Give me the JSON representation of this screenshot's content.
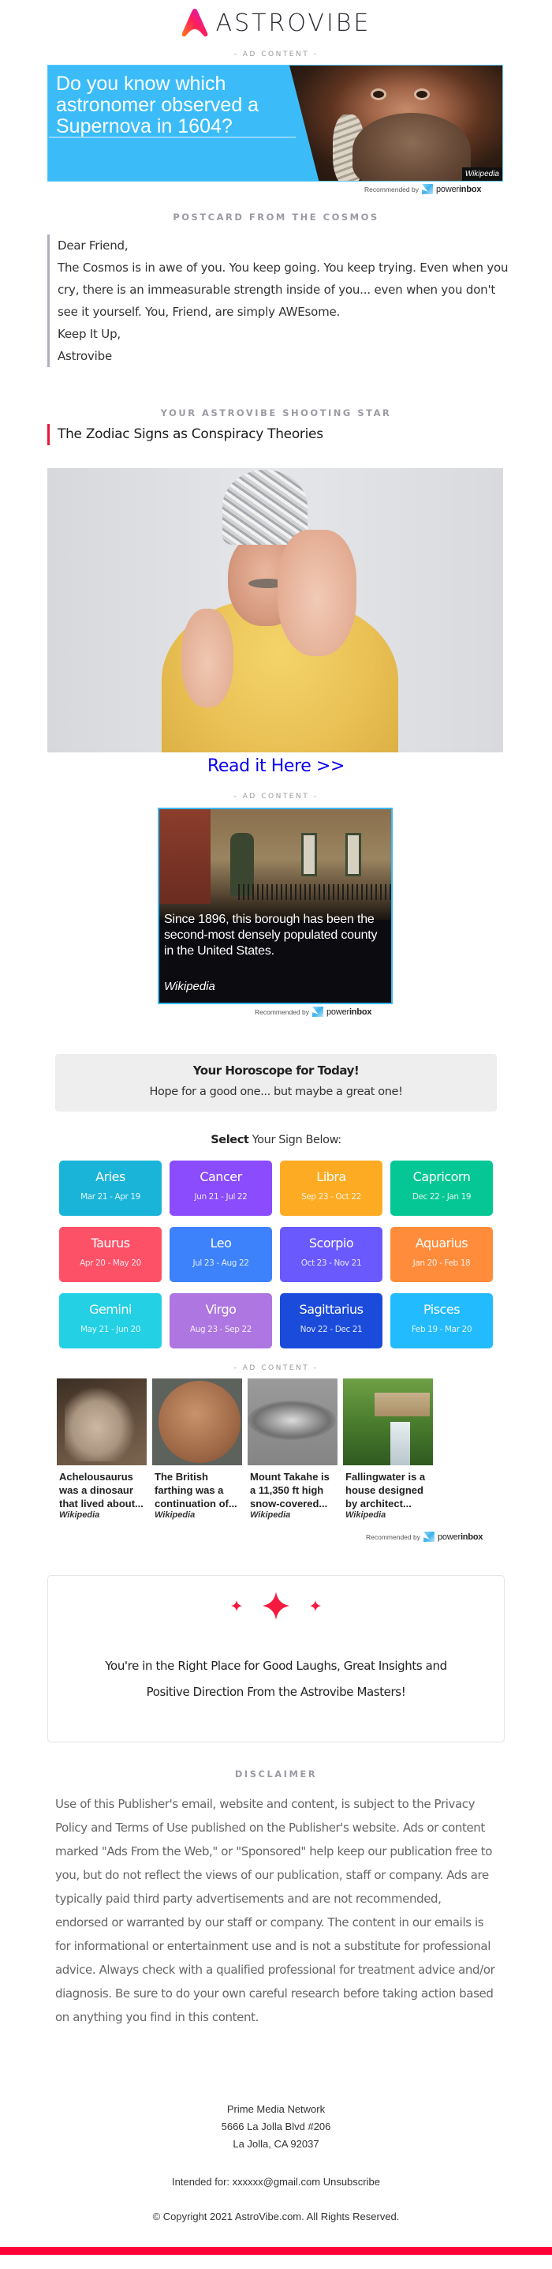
{
  "brand": {
    "name": "ASTROVIBE",
    "accent_color": "#e8173a",
    "bottom_bar_color": "#ff0037"
  },
  "ads": {
    "label": "- AD CONTENT -",
    "recommended_by": "Recommended by",
    "provider_prefix": "power",
    "provider_suffix": "inbox",
    "top_banner": {
      "headline": "Do you know which astronomer observed a Supernova in 1604?",
      "source": "Wikipedia",
      "background_color": "#3bbcf9"
    },
    "middle_banner": {
      "headline": "Since 1896, this borough has been the second-most densely populated county in the United States.",
      "source": "Wikipedia"
    },
    "grid": [
      {
        "title": "Achelousaurus was a dinosaur that lived about...",
        "source": "Wikipedia",
        "image": "dinosaur-fossil"
      },
      {
        "title": "The British farthing was a continuation of...",
        "source": "Wikipedia",
        "image": "copper-coin"
      },
      {
        "title": "Mount Takahe is a 11,350 ft high snow-covered...",
        "source": "Wikipedia",
        "image": "mountain-aerial"
      },
      {
        "title": "Fallingwater is a house designed by architect...",
        "source": "Wikipedia",
        "image": "house-waterfall"
      }
    ]
  },
  "postcard": {
    "heading": "POSTCARD FROM THE COSMOS",
    "greeting": "Dear Friend,",
    "body": "The Cosmos is in awe of you. You keep going. You keep trying. Even when you cry, there is an immeasurable strength inside of you... even when you don't see it yourself. You, Friend, are simply AWEsome.",
    "signoff": "Keep It Up,",
    "signature": "Astrovibe"
  },
  "shooting_star": {
    "heading": "YOUR ASTROVIBE SHOOTING STAR",
    "article_title": "The Zodiac Signs as Conspiracy Theories",
    "image_description": "man-in-tinfoil-hat",
    "cta": "Read it Here >>",
    "cta_color": "#0a00f0"
  },
  "horoscope": {
    "title": "Your Horoscope for Today!",
    "subtitle": "Hope for a good one... but maybe a great one!",
    "select_bold": "Select",
    "select_rest": " Your Sign Below:",
    "signs": [
      {
        "name": "Aries",
        "dates": "Mar 21 - Apr 19",
        "color": "#1ab4d8"
      },
      {
        "name": "Cancer",
        "dates": "Jun 21 - Jul 22",
        "color": "#8a4cfc"
      },
      {
        "name": "Libra",
        "dates": "Sep 23 - Oct 22",
        "color": "#fdab22"
      },
      {
        "name": "Capricorn",
        "dates": "Dec 22 - Jan 19",
        "color": "#05c795"
      },
      {
        "name": "Taurus",
        "dates": "Apr 20 - May 20",
        "color": "#fd5168"
      },
      {
        "name": "Leo",
        "dates": "Jul 23 - Aug 22",
        "color": "#3d82fb"
      },
      {
        "name": "Scorpio",
        "dates": "Oct 23 - Nov 21",
        "color": "#6a5afd"
      },
      {
        "name": "Aquarius",
        "dates": "Jan 20 - Feb 18",
        "color": "#fe8c3b"
      },
      {
        "name": "Gemini",
        "dates": "May 21 - Jun 20",
        "color": "#23d0e4"
      },
      {
        "name": "Virgo",
        "dates": "Aug 23 - Sep 22",
        "color": "#ad76e0"
      },
      {
        "name": "Sagittarius",
        "dates": "Nov 22 - Dec 21",
        "color": "#1b4bdb"
      },
      {
        "name": "Pisces",
        "dates": "Feb 19 - Mar 20",
        "color": "#22bbfd"
      }
    ]
  },
  "laughs": {
    "line1": "You're in the Right Place for Good Laughs, Great Insights and",
    "line2": "Positive Direction From the Astrovibe Masters!",
    "sparkle_color": "#f5183f"
  },
  "disclaimer": {
    "heading": "DISCLAIMER",
    "text": "Use of this Publisher's email, website and content, is subject to the Privacy Policy and Terms of Use published on the Publisher's website. Ads or content marked \"Ads From the Web,\" or \"Sponsored\" help keep our publication free to you, but do not reflect the views of our publication, staff or company. Ads are typically paid third party advertisements and are not recommended, endorsed or warranted by our staff or company. The content in our emails is for informational or entertainment use and is not a substitute for professional advice. Always check with a qualified professional for treatment advice and/or diagnosis. Be sure to do your own careful research before taking action based on anything you find in this content."
  },
  "footer": {
    "company": "Prime Media Network",
    "address1": "5666 La Jolla Blvd #206",
    "address2": "La Jolla, CA 92037",
    "intended_label": "Intended for: xxxxxx@gmail.com",
    "unsubscribe": "Unsubscribe",
    "copyright": "© Copyright 2021 AstroVibe.com. All Rights Reserved."
  }
}
